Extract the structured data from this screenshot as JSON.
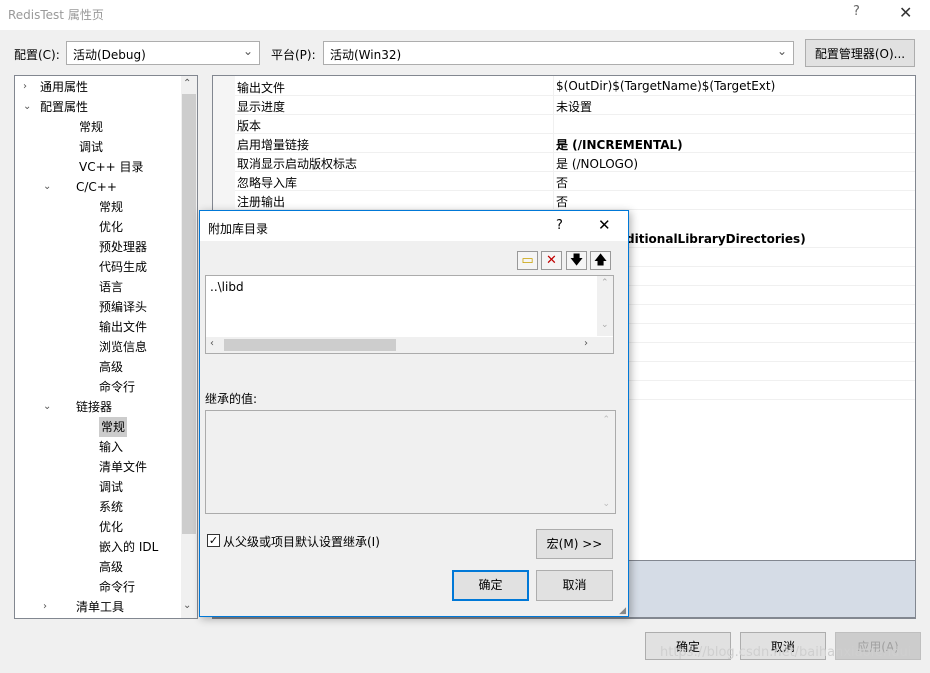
{
  "window": {
    "title": "RedisTest 属性页",
    "help": "?",
    "close": "✕"
  },
  "config": {
    "label": "配置(C):",
    "value": "活动(Debug)"
  },
  "platform": {
    "label": "平台(P):",
    "value": "活动(Win32)"
  },
  "config_manager_label": "配置管理器(O)...",
  "tree": {
    "items": [
      {
        "label": "通用属性",
        "arrow": "›"
      },
      {
        "label": "配置属性",
        "arrow": "⌄"
      },
      {
        "label": "常规"
      },
      {
        "label": "调试"
      },
      {
        "label": "VC++ 目录"
      },
      {
        "label": "C/C++",
        "arrow": "⌄"
      },
      {
        "label": "常规"
      },
      {
        "label": "优化"
      },
      {
        "label": "预处理器"
      },
      {
        "label": "代码生成"
      },
      {
        "label": "语言"
      },
      {
        "label": "预编译头"
      },
      {
        "label": "输出文件"
      },
      {
        "label": "浏览信息"
      },
      {
        "label": "高级"
      },
      {
        "label": "命令行"
      },
      {
        "label": "链接器",
        "arrow": "⌄"
      },
      {
        "label": "常规"
      },
      {
        "label": "输入"
      },
      {
        "label": "清单文件"
      },
      {
        "label": "调试"
      },
      {
        "label": "系统"
      },
      {
        "label": "优化"
      },
      {
        "label": "嵌入的 IDL"
      },
      {
        "label": "高级"
      },
      {
        "label": "命令行"
      },
      {
        "label": "清单工具",
        "arrow": "›"
      }
    ]
  },
  "grid": {
    "rows": [
      {
        "key": "输出文件",
        "value": "$(OutDir)$(TargetName)$(TargetExt)"
      },
      {
        "key": "显示进度",
        "value": "未设置"
      },
      {
        "key": "版本",
        "value": ""
      },
      {
        "key": "启用增量链接",
        "value": "是 (/INCREMENTAL)"
      },
      {
        "key": "取消显示启动版权标志",
        "value": "是 (/NOLOGO)"
      },
      {
        "key": "忽略导入库",
        "value": "否"
      },
      {
        "key": "注册输出",
        "value": "否"
      }
    ],
    "partial_value": "ditionalLibraryDirectories)"
  },
  "dialog": {
    "title": "附加库目录",
    "help": "?",
    "close": "✕",
    "entry": "..\\libd",
    "inherited_label": "继承的值:",
    "inherit_checkbox": "从父级或项目默认设置继承(I)",
    "macro_label": "宏(M) >>",
    "ok_label": "确定",
    "cancel_label": "取消"
  },
  "footer": {
    "ok": "确定",
    "cancel": "取消",
    "apply": "应用(A)"
  },
  "watermark": "https://blog.csdn.net/baihanxiaofendui"
}
